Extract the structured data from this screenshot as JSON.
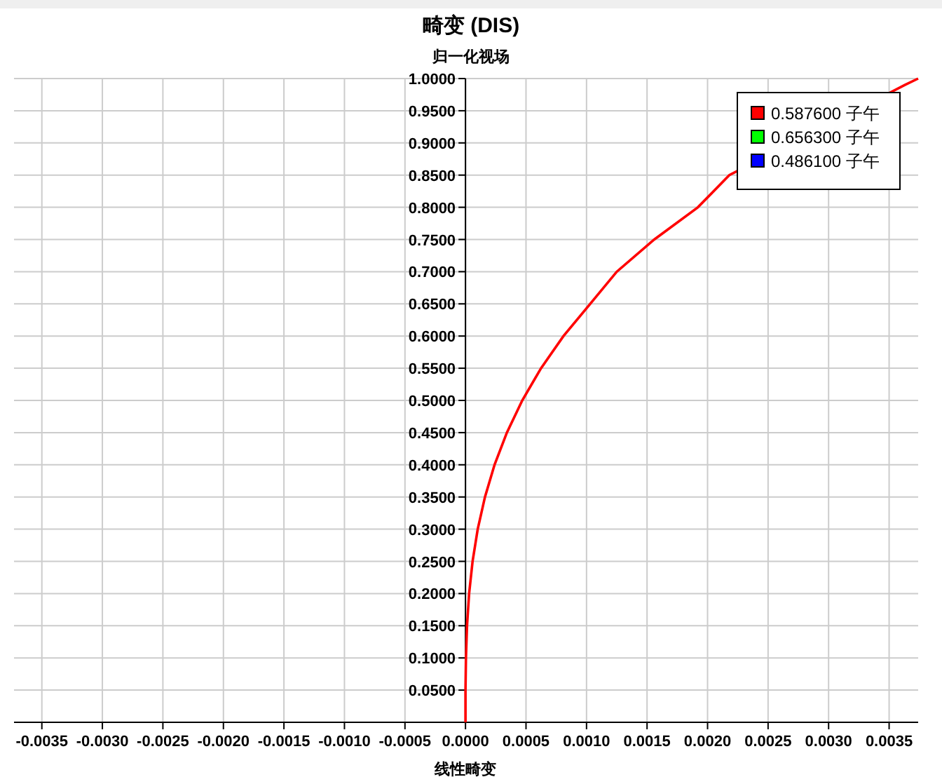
{
  "plot": {
    "title": "畸变 (DIS)",
    "chart_data": {
      "type": "line",
      "title": "归一化视场",
      "xlabel": "线性畸变",
      "grid": true,
      "legend": true,
      "x": [
        0,
        0,
        3.8e-06,
        1.27e-05,
        3e-05,
        5.86e-05,
        0.000101,
        0.000161,
        0.00024,
        0.000342,
        0.000469,
        0.000624,
        0.00081,
        0.00103,
        0.00125,
        0.00156,
        0.00192,
        0.00218,
        0.00363,
        0.00374
      ],
      "series": [
        {
          "name": "0.587600 子午",
          "color": "#ff0000",
          "values": [
            0,
            0.05,
            0.1,
            0.15,
            0.2,
            0.25,
            0.3,
            0.35,
            0.4,
            0.45,
            0.5,
            0.55,
            0.6,
            0.65,
            0.7,
            0.75,
            0.8,
            0.85,
            0.99,
            1
          ]
        },
        {
          "name": "0.656300 子午",
          "color": "#00ff00",
          "values": [
            null,
            null,
            null,
            null,
            null,
            null,
            null,
            null,
            null,
            null,
            null,
            null,
            null,
            null,
            null,
            null,
            null,
            null,
            null,
            null
          ]
        },
        {
          "name": "0.486100 子午",
          "color": "#0000ff",
          "values": [
            null,
            null,
            null,
            null,
            null,
            null,
            null,
            null,
            null,
            null,
            null,
            null,
            null,
            null,
            null,
            null,
            null,
            null,
            null,
            null
          ]
        }
      ],
      "xlim": [
        -0.00373,
        0.00374
      ],
      "ylim": [
        0,
        1
      ],
      "xticks": [
        {
          "value": -0.0035,
          "label": "-0.0035"
        },
        {
          "value": -0.003,
          "label": "-0.0030"
        },
        {
          "value": -0.0025,
          "label": "-0.0025"
        },
        {
          "value": -0.002,
          "label": "-0.0020"
        },
        {
          "value": -0.0015,
          "label": "-0.0015"
        },
        {
          "value": -0.001,
          "label": "-0.0010"
        },
        {
          "value": -0.0005,
          "label": "-0.0005"
        },
        {
          "value": 0,
          "label": "0.0000"
        },
        {
          "value": 0.0005,
          "label": "0.0005"
        },
        {
          "value": 0.001,
          "label": "0.0010"
        },
        {
          "value": 0.0015,
          "label": "0.0015"
        },
        {
          "value": 0.002,
          "label": "0.0020"
        },
        {
          "value": 0.0025,
          "label": "0.0025"
        },
        {
          "value": 0.003,
          "label": "0.0030"
        },
        {
          "value": 0.0035,
          "label": "0.0035"
        }
      ],
      "yticks": [
        {
          "value": 0.05,
          "label": "0.0500"
        },
        {
          "value": 0.1,
          "label": "0.1000"
        },
        {
          "value": 0.15,
          "label": "0.1500"
        },
        {
          "value": 0.2,
          "label": "0.2000"
        },
        {
          "value": 0.25,
          "label": "0.2500"
        },
        {
          "value": 0.3,
          "label": "0.3000"
        },
        {
          "value": 0.35,
          "label": "0.3500"
        },
        {
          "value": 0.4,
          "label": "0.4000"
        },
        {
          "value": 0.45,
          "label": "0.4500"
        },
        {
          "value": 0.5,
          "label": "0.5000"
        },
        {
          "value": 0.55,
          "label": "0.5500"
        },
        {
          "value": 0.6,
          "label": "0.6000"
        },
        {
          "value": 0.65,
          "label": "0.6500"
        },
        {
          "value": 0.7,
          "label": "0.7000"
        },
        {
          "value": 0.75,
          "label": "0.7500"
        },
        {
          "value": 0.8,
          "label": "0.8000"
        },
        {
          "value": 0.85,
          "label": "0.8500"
        },
        {
          "value": 0.9,
          "label": "0.9000"
        },
        {
          "value": 0.95,
          "label": "0.9500"
        },
        {
          "value": 1,
          "label": "1.0000"
        }
      ]
    }
  }
}
